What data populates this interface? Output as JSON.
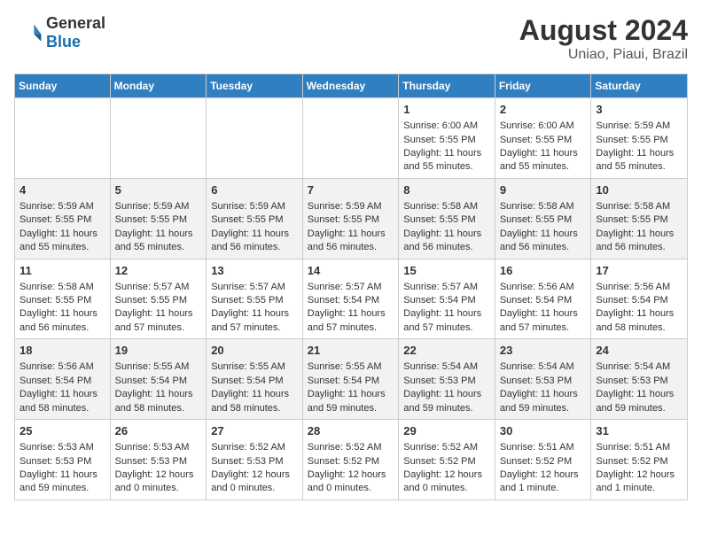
{
  "header": {
    "logo_general": "General",
    "logo_blue": "Blue",
    "month_year": "August 2024",
    "location": "Uniao, Piaui, Brazil"
  },
  "weekdays": [
    "Sunday",
    "Monday",
    "Tuesday",
    "Wednesday",
    "Thursday",
    "Friday",
    "Saturday"
  ],
  "weeks": [
    [
      {
        "day": "",
        "info": ""
      },
      {
        "day": "",
        "info": ""
      },
      {
        "day": "",
        "info": ""
      },
      {
        "day": "",
        "info": ""
      },
      {
        "day": "1",
        "info": "Sunrise: 6:00 AM\nSunset: 5:55 PM\nDaylight: 11 hours\nand 55 minutes."
      },
      {
        "day": "2",
        "info": "Sunrise: 6:00 AM\nSunset: 5:55 PM\nDaylight: 11 hours\nand 55 minutes."
      },
      {
        "day": "3",
        "info": "Sunrise: 5:59 AM\nSunset: 5:55 PM\nDaylight: 11 hours\nand 55 minutes."
      }
    ],
    [
      {
        "day": "4",
        "info": "Sunrise: 5:59 AM\nSunset: 5:55 PM\nDaylight: 11 hours\nand 55 minutes."
      },
      {
        "day": "5",
        "info": "Sunrise: 5:59 AM\nSunset: 5:55 PM\nDaylight: 11 hours\nand 55 minutes."
      },
      {
        "day": "6",
        "info": "Sunrise: 5:59 AM\nSunset: 5:55 PM\nDaylight: 11 hours\nand 56 minutes."
      },
      {
        "day": "7",
        "info": "Sunrise: 5:59 AM\nSunset: 5:55 PM\nDaylight: 11 hours\nand 56 minutes."
      },
      {
        "day": "8",
        "info": "Sunrise: 5:58 AM\nSunset: 5:55 PM\nDaylight: 11 hours\nand 56 minutes."
      },
      {
        "day": "9",
        "info": "Sunrise: 5:58 AM\nSunset: 5:55 PM\nDaylight: 11 hours\nand 56 minutes."
      },
      {
        "day": "10",
        "info": "Sunrise: 5:58 AM\nSunset: 5:55 PM\nDaylight: 11 hours\nand 56 minutes."
      }
    ],
    [
      {
        "day": "11",
        "info": "Sunrise: 5:58 AM\nSunset: 5:55 PM\nDaylight: 11 hours\nand 56 minutes."
      },
      {
        "day": "12",
        "info": "Sunrise: 5:57 AM\nSunset: 5:55 PM\nDaylight: 11 hours\nand 57 minutes."
      },
      {
        "day": "13",
        "info": "Sunrise: 5:57 AM\nSunset: 5:55 PM\nDaylight: 11 hours\nand 57 minutes."
      },
      {
        "day": "14",
        "info": "Sunrise: 5:57 AM\nSunset: 5:54 PM\nDaylight: 11 hours\nand 57 minutes."
      },
      {
        "day": "15",
        "info": "Sunrise: 5:57 AM\nSunset: 5:54 PM\nDaylight: 11 hours\nand 57 minutes."
      },
      {
        "day": "16",
        "info": "Sunrise: 5:56 AM\nSunset: 5:54 PM\nDaylight: 11 hours\nand 57 minutes."
      },
      {
        "day": "17",
        "info": "Sunrise: 5:56 AM\nSunset: 5:54 PM\nDaylight: 11 hours\nand 58 minutes."
      }
    ],
    [
      {
        "day": "18",
        "info": "Sunrise: 5:56 AM\nSunset: 5:54 PM\nDaylight: 11 hours\nand 58 minutes."
      },
      {
        "day": "19",
        "info": "Sunrise: 5:55 AM\nSunset: 5:54 PM\nDaylight: 11 hours\nand 58 minutes."
      },
      {
        "day": "20",
        "info": "Sunrise: 5:55 AM\nSunset: 5:54 PM\nDaylight: 11 hours\nand 58 minutes."
      },
      {
        "day": "21",
        "info": "Sunrise: 5:55 AM\nSunset: 5:54 PM\nDaylight: 11 hours\nand 59 minutes."
      },
      {
        "day": "22",
        "info": "Sunrise: 5:54 AM\nSunset: 5:53 PM\nDaylight: 11 hours\nand 59 minutes."
      },
      {
        "day": "23",
        "info": "Sunrise: 5:54 AM\nSunset: 5:53 PM\nDaylight: 11 hours\nand 59 minutes."
      },
      {
        "day": "24",
        "info": "Sunrise: 5:54 AM\nSunset: 5:53 PM\nDaylight: 11 hours\nand 59 minutes."
      }
    ],
    [
      {
        "day": "25",
        "info": "Sunrise: 5:53 AM\nSunset: 5:53 PM\nDaylight: 11 hours\nand 59 minutes."
      },
      {
        "day": "26",
        "info": "Sunrise: 5:53 AM\nSunset: 5:53 PM\nDaylight: 12 hours\nand 0 minutes."
      },
      {
        "day": "27",
        "info": "Sunrise: 5:52 AM\nSunset: 5:53 PM\nDaylight: 12 hours\nand 0 minutes."
      },
      {
        "day": "28",
        "info": "Sunrise: 5:52 AM\nSunset: 5:52 PM\nDaylight: 12 hours\nand 0 minutes."
      },
      {
        "day": "29",
        "info": "Sunrise: 5:52 AM\nSunset: 5:52 PM\nDaylight: 12 hours\nand 0 minutes."
      },
      {
        "day": "30",
        "info": "Sunrise: 5:51 AM\nSunset: 5:52 PM\nDaylight: 12 hours\nand 1 minute."
      },
      {
        "day": "31",
        "info": "Sunrise: 5:51 AM\nSunset: 5:52 PM\nDaylight: 12 hours\nand 1 minute."
      }
    ]
  ]
}
